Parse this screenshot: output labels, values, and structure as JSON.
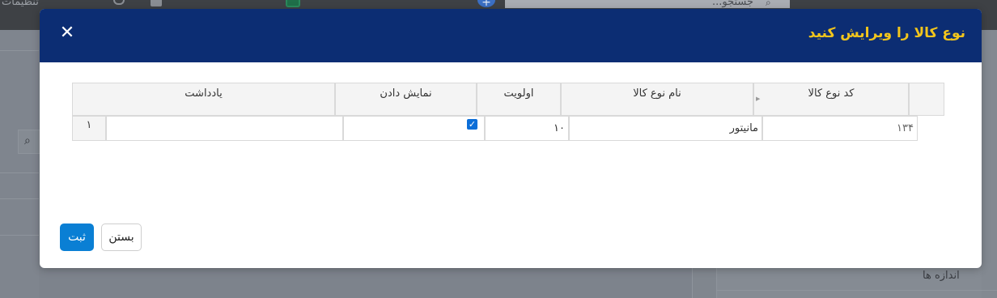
{
  "background": {
    "settings_label": "تنظیمات",
    "search_placeholder": "جستجو...",
    "sizes_label": "اندازه ها"
  },
  "modal": {
    "title": "نوع کالا را ویرایش کنید",
    "close_icon": "close-icon",
    "columns": {
      "code": "کد نوع کالا",
      "name": "نام نوع کالا",
      "priority": "اولویت",
      "display": "نمایش دادن",
      "note": "یادداشت"
    },
    "row": {
      "number": "۱",
      "code": "۱۳۴",
      "name": "مانیتور",
      "priority": "۱۰",
      "display_checked": true,
      "note": ""
    },
    "buttons": {
      "submit": "ثبت",
      "close": "بستن"
    }
  },
  "colors": {
    "header_bg": "#0c2d73",
    "title_text": "#f2c51c",
    "primary_button": "#0a7fd4"
  }
}
